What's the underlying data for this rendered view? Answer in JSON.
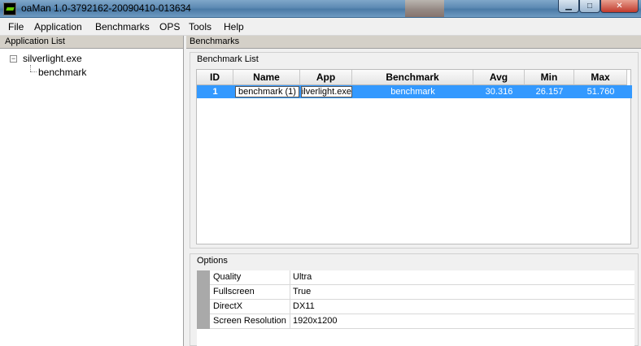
{
  "window": {
    "title": "oaMan 1.0-3792162-20090410-013634",
    "min_glyph": "▁",
    "max_glyph": "□",
    "close_glyph": "✕"
  },
  "menu": [
    "File",
    "Application",
    "Benchmarks",
    "OPS",
    "Tools",
    "Help"
  ],
  "left_pane": {
    "header": "Application List",
    "tree": {
      "toggle": "−",
      "root": "silverlight.exe",
      "child": "benchmark"
    }
  },
  "right_pane": {
    "header": "Benchmarks",
    "benchmark_list": {
      "label": "Benchmark List",
      "columns": [
        "ID",
        "Name",
        "App",
        "Benchmark",
        "Avg",
        "Min",
        "Max"
      ],
      "rows": [
        {
          "id": "1",
          "name": "benchmark (1)",
          "app": "silverlight.exe",
          "benchmark": "benchmark",
          "avg": "30.316",
          "min": "26.157",
          "max": "51.760"
        }
      ]
    },
    "options": {
      "label": "Options",
      "rows": [
        {
          "name": "Quality",
          "value": "Ultra"
        },
        {
          "name": "Fullscreen",
          "value": "True"
        },
        {
          "name": "DirectX",
          "value": "DX11"
        },
        {
          "name": "Screen Resolution",
          "value": "1920x1200"
        }
      ]
    }
  },
  "colors": {
    "selection": "#3399ff",
    "titlebar": "#5d8ab3"
  }
}
